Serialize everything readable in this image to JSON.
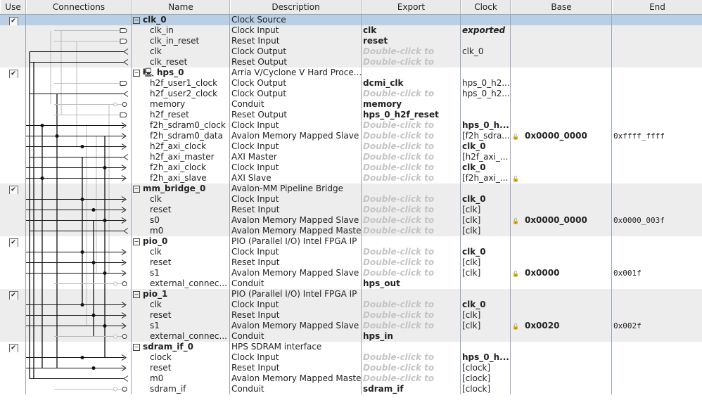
{
  "headers": [
    "Use",
    "Connections",
    "Name",
    "Description",
    "Export",
    "Clock",
    "Base",
    "End"
  ],
  "export_placeholder": "Double-click to",
  "rows": [
    {
      "type": "module",
      "name": "clk_0",
      "desc": "Clock Source",
      "use": true,
      "selected": true,
      "group": 0
    },
    {
      "name": "clk_in",
      "desc": "Clock Input",
      "export": "clk",
      "clock": "exported",
      "clock_style": "ital",
      "group": 0,
      "sym": "in"
    },
    {
      "name": "clk_in_reset",
      "desc": "Reset Input",
      "export": "reset",
      "group": 0,
      "sym": "in"
    },
    {
      "name": "clk",
      "desc": "Clock Output",
      "clock": "clk_0",
      "group": 0,
      "sym": "out"
    },
    {
      "name": "clk_reset",
      "desc": "Reset Output",
      "group": 0,
      "sym": "out"
    },
    {
      "type": "module",
      "name": "hps_0",
      "desc": "Arria V/Cyclone V Hard Proce...",
      "use": true,
      "group": 1,
      "icon": true
    },
    {
      "name": "h2f_user1_clock",
      "desc": "Clock Output",
      "export": "dcmi_clk",
      "clock": "hps_0_h2...",
      "group": 1,
      "sym": "in"
    },
    {
      "name": "h2f_user2_clock",
      "desc": "Clock Output",
      "clock": "hps_0_h2...",
      "group": 1,
      "sym": "out"
    },
    {
      "name": "memory",
      "desc": "Conduit",
      "export": "memory",
      "group": 1,
      "sym": "cond"
    },
    {
      "name": "h2f_reset",
      "desc": "Reset Output",
      "export": "hps_0_h2f_reset",
      "group": 1,
      "sym": "in"
    },
    {
      "name": "f2h_sdram0_clock",
      "desc": "Clock Input",
      "clock": "hps_0_h...",
      "clock_style": "bold",
      "group": 1,
      "sym": "arrow"
    },
    {
      "name": "f2h_sdram0_data",
      "desc": "Avalon Memory Mapped Slave",
      "clock": "[f2h_sdra...",
      "base": "0x0000_0000",
      "end": "0xffff_ffff",
      "lock": true,
      "group": 1,
      "sym": "arrow"
    },
    {
      "name": "h2f_axi_clock",
      "desc": "Clock Input",
      "clock": "clk_0",
      "clock_style": "bold",
      "group": 1,
      "sym": "arrow"
    },
    {
      "name": "h2f_axi_master",
      "desc": "AXI Master",
      "clock": "[h2f_axi_...",
      "group": 1,
      "sym": "out"
    },
    {
      "name": "f2h_axi_clock",
      "desc": "Clock Input",
      "clock": "clk_0",
      "clock_style": "bold",
      "group": 1,
      "sym": "arrow"
    },
    {
      "name": "f2h_axi_slave",
      "desc": "AXI Slave",
      "clock": "[f2h_axi_...",
      "lock": true,
      "group": 1,
      "sym": "arrow"
    },
    {
      "type": "module",
      "name": "mm_bridge_0",
      "desc": "Avalon-MM Pipeline Bridge",
      "use": true,
      "group": 0
    },
    {
      "name": "clk",
      "desc": "Clock Input",
      "clock": "clk_0",
      "clock_style": "bold",
      "group": 0,
      "sym": "arrow"
    },
    {
      "name": "reset",
      "desc": "Reset Input",
      "clock": "[clk]",
      "group": 0,
      "sym": "arrow"
    },
    {
      "name": "s0",
      "desc": "Avalon Memory Mapped Slave",
      "clock": "[clk]",
      "base": "0x0000_0000",
      "end": "0x0000_003f",
      "lock": true,
      "group": 0,
      "sym": "arrow"
    },
    {
      "name": "m0",
      "desc": "Avalon Memory Mapped Master",
      "clock": "[clk]",
      "group": 0,
      "sym": "out"
    },
    {
      "type": "module",
      "name": "pio_0",
      "desc": "PIO (Parallel I/O) Intel FPGA IP",
      "use": true,
      "group": 1
    },
    {
      "name": "clk",
      "desc": "Clock Input",
      "clock": "clk_0",
      "clock_style": "bold",
      "group": 1,
      "sym": "arrow"
    },
    {
      "name": "reset",
      "desc": "Reset Input",
      "clock": "[clk]",
      "group": 1,
      "sym": "arrow"
    },
    {
      "name": "s1",
      "desc": "Avalon Memory Mapped Slave",
      "clock": "[clk]",
      "base": "0x0000",
      "end": "0x001f",
      "lock": true,
      "group": 1,
      "sym": "arrow"
    },
    {
      "name": "external_connec...",
      "desc": "Conduit",
      "export": "hps_out",
      "group": 1,
      "sym": "cond"
    },
    {
      "type": "module",
      "name": "pio_1",
      "desc": "PIO (Parallel I/O) Intel FPGA IP",
      "use": true,
      "group": 0
    },
    {
      "name": "clk",
      "desc": "Clock Input",
      "clock": "clk_0",
      "clock_style": "bold",
      "group": 0,
      "sym": "arrow"
    },
    {
      "name": "reset",
      "desc": "Reset Input",
      "clock": "[clk]",
      "group": 0,
      "sym": "arrow"
    },
    {
      "name": "s1",
      "desc": "Avalon Memory Mapped Slave",
      "clock": "[clk]",
      "base": "0x0020",
      "end": "0x002f",
      "lock": true,
      "group": 0,
      "sym": "arrow"
    },
    {
      "name": "external_connec...",
      "desc": "Conduit",
      "export": "hps_in",
      "group": 0,
      "sym": "cond"
    },
    {
      "type": "module",
      "name": "sdram_if_0",
      "desc": "HPS SDRAM interface",
      "use": true,
      "group": 1
    },
    {
      "name": "clock",
      "desc": "Clock Input",
      "clock": "hps_0_h...",
      "clock_style": "bold",
      "group": 1,
      "sym": "arrow"
    },
    {
      "name": "reset",
      "desc": "Reset Input",
      "clock": "[clock]",
      "group": 1,
      "sym": "arrow"
    },
    {
      "name": "m0",
      "desc": "Avalon Memory Mapped Master",
      "clock": "[clock]",
      "group": 1,
      "sym": "out"
    },
    {
      "name": "sdram_if",
      "desc": "Conduit",
      "export": "sdram_if",
      "clock": "[clock]",
      "group": 1,
      "sym": "cond"
    }
  ]
}
